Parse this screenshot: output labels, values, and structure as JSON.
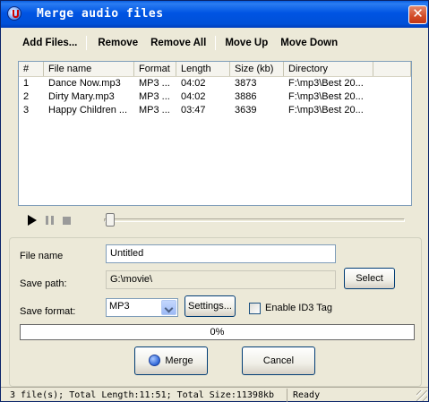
{
  "window": {
    "title": "Merge audio files"
  },
  "toolbar": {
    "add_files": "Add Files...",
    "remove": "Remove",
    "remove_all": "Remove All",
    "move_up": "Move Up",
    "move_down": "Move Down"
  },
  "table": {
    "columns": [
      "#",
      "File name",
      "Format",
      "Length",
      "Size (kb)",
      "Directory",
      ""
    ],
    "rows": [
      [
        "1",
        "Dance Now.mp3",
        "MP3 ...",
        "04:02",
        "3873",
        "F:\\mp3\\Best 20..."
      ],
      [
        "2",
        "Dirty Mary.mp3",
        "MP3 ...",
        "04:02",
        "3886",
        "F:\\mp3\\Best 20..."
      ],
      [
        "3",
        "Happy Children ...",
        "MP3 ...",
        "03:47",
        "3639",
        "F:\\mp3\\Best 20..."
      ]
    ]
  },
  "form": {
    "file_name_label": "File name",
    "file_name_value": "Untitled",
    "save_path_label": "Save path:",
    "save_path_value": "G:\\movie\\",
    "select_button": "Select",
    "save_format_label": "Save format:",
    "save_format_value": "MP3",
    "settings_button": "Settings...",
    "id3_label": "Enable ID3 Tag",
    "id3_checked": false
  },
  "progress": {
    "percent": 0,
    "text": "0%"
  },
  "actions": {
    "merge": "Merge",
    "cancel": "Cancel"
  },
  "status": {
    "summary": "3 file(s); Total Length:11:51; Total Size:11398kb",
    "state": "Ready"
  },
  "colors": {
    "titlebar": "#0054e3",
    "progress_fill": "#2aa7e4",
    "close": "#d24a27"
  }
}
